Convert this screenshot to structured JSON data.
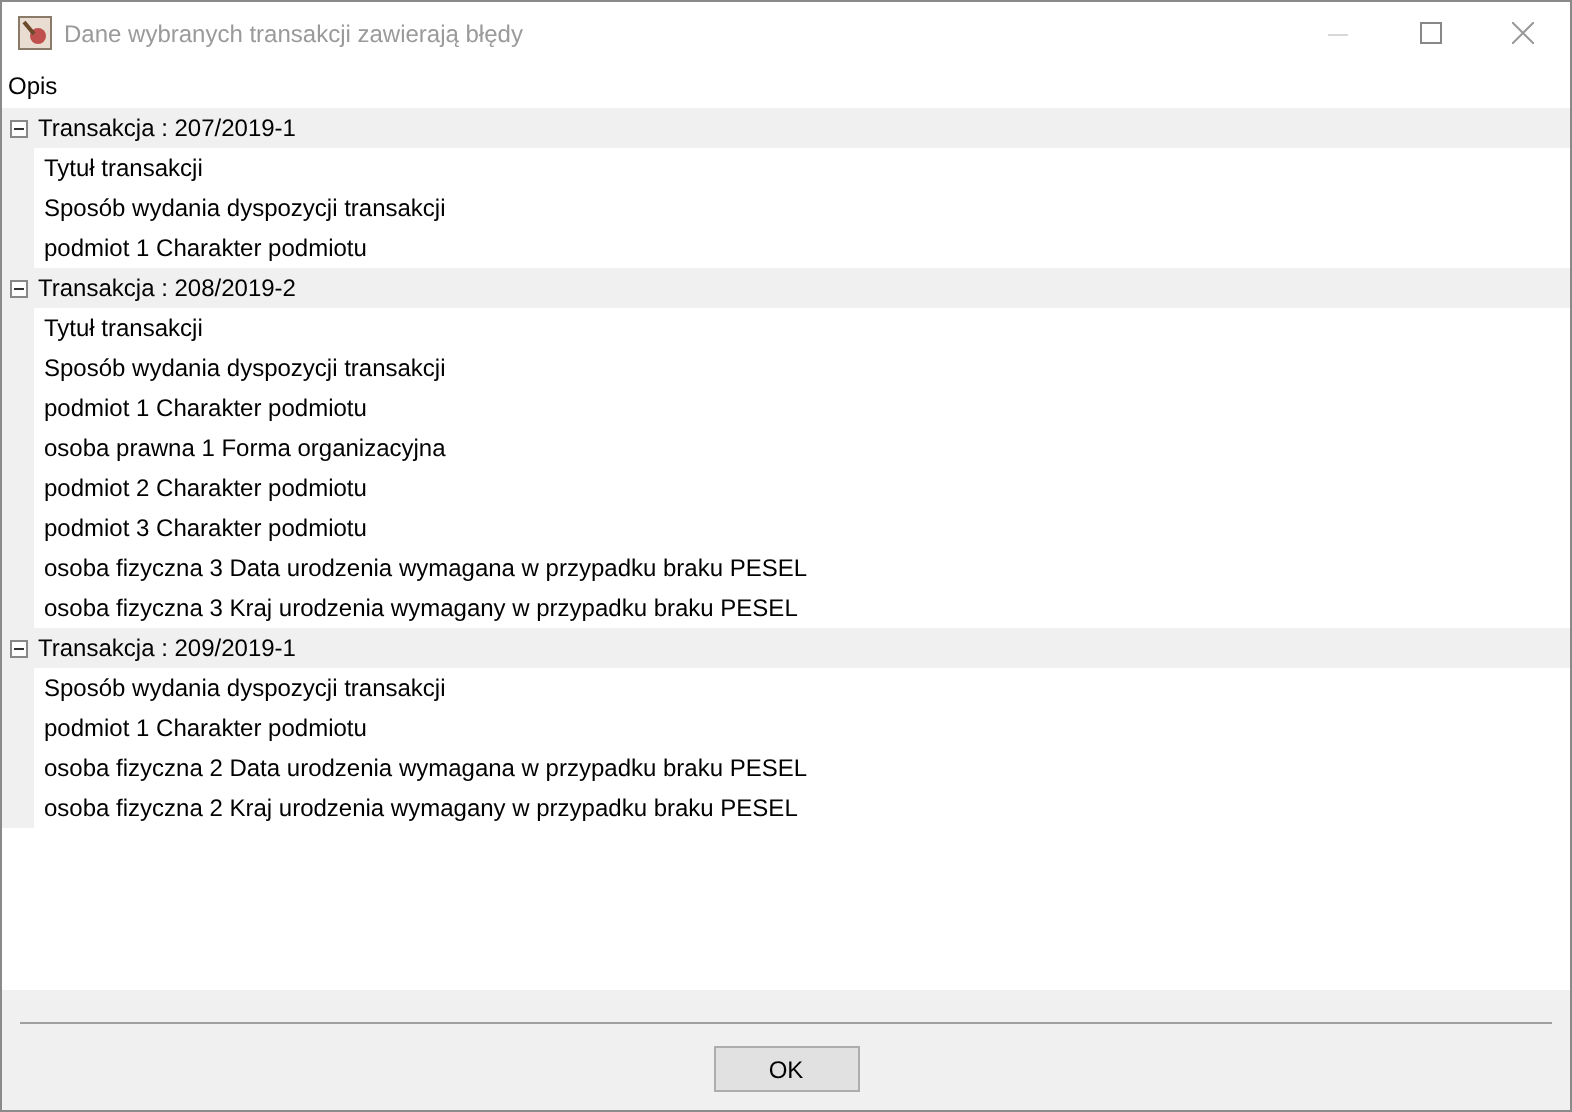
{
  "window": {
    "title": "Dane wybranych transakcji zawierają błędy"
  },
  "column_header": "Opis",
  "groups": [
    {
      "label": "Transakcja : 207/2019-1",
      "expanded": true,
      "children": [
        "Tytuł transakcji",
        "Sposób wydania dyspozycji transakcji",
        "podmiot 1 Charakter podmiotu"
      ]
    },
    {
      "label": "Transakcja : 208/2019-2",
      "expanded": true,
      "children": [
        "Tytuł transakcji",
        "Sposób wydania dyspozycji transakcji",
        "podmiot 1 Charakter podmiotu",
        "osoba prawna 1 Forma organizacyjna",
        "podmiot 2 Charakter podmiotu",
        "podmiot 3 Charakter podmiotu",
        "osoba fizyczna 3 Data urodzenia wymagana w przypadku braku PESEL",
        "osoba fizyczna 3 Kraj urodzenia wymagany w przypadku braku PESEL"
      ]
    },
    {
      "label": "Transakcja : 209/2019-1",
      "expanded": true,
      "children": [
        "Sposób wydania dyspozycji transakcji",
        "podmiot 1 Charakter podmiotu",
        "osoba fizyczna 2 Data urodzenia wymagana w przypadku braku PESEL",
        "osoba fizyczna 2 Kraj urodzenia wymagany w przypadku braku PESEL"
      ]
    }
  ],
  "buttons": [
    "OK"
  ]
}
